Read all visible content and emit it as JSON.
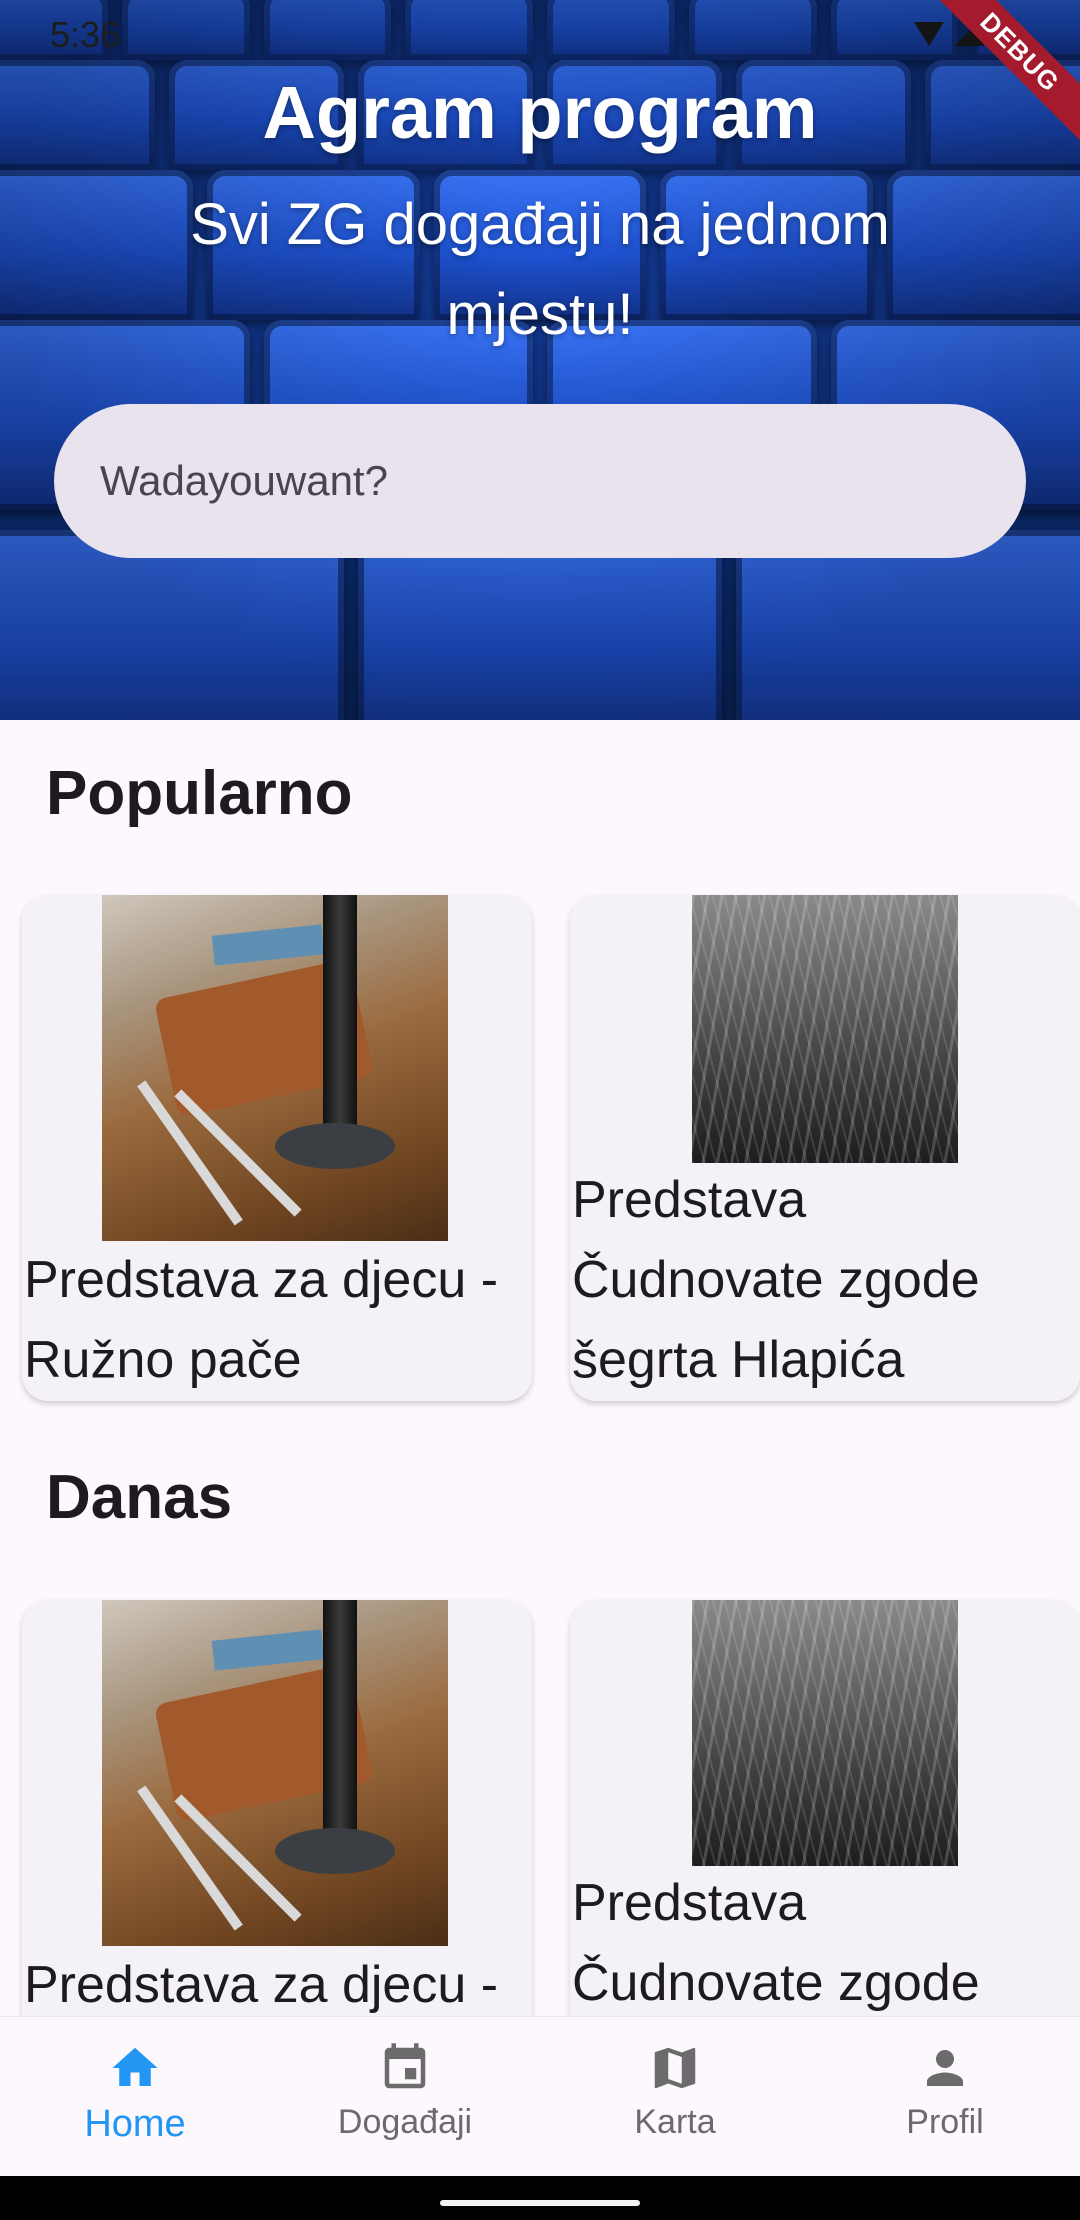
{
  "status_bar": {
    "time": "5:36"
  },
  "debug_banner": "DEBUG",
  "hero": {
    "title": "Agram program",
    "subtitle": "Svi ZG događaji na jednom mjestu!",
    "search_placeholder": "Wadayouwant?"
  },
  "sections": [
    {
      "title": "Popularno",
      "cards": [
        {
          "title": "Predstava za djecu - Ružno pače",
          "image": "desk-tools-photo"
        },
        {
          "title": "Predstava Čudnovate zgode šegrta Hlapića",
          "image": "grass-bw-photo"
        }
      ]
    },
    {
      "title": "Danas",
      "cards": [
        {
          "title": "Predstava za djecu -",
          "image": "desk-tools-photo"
        },
        {
          "title": "Predstava Čudnovate zgode",
          "image": "grass-bw-photo"
        }
      ]
    }
  ],
  "bottom_nav": {
    "items": [
      {
        "label": "Home",
        "icon": "home-icon",
        "active": true
      },
      {
        "label": "Događaji",
        "icon": "calendar-icon",
        "active": false
      },
      {
        "label": "Karta",
        "icon": "map-icon",
        "active": false
      },
      {
        "label": "Profil",
        "icon": "person-icon",
        "active": false
      }
    ]
  },
  "colors": {
    "accent": "#2196f3",
    "background": "#fdf7fe",
    "card": "#f5f2f7",
    "search_field": "#e9e3ee"
  }
}
